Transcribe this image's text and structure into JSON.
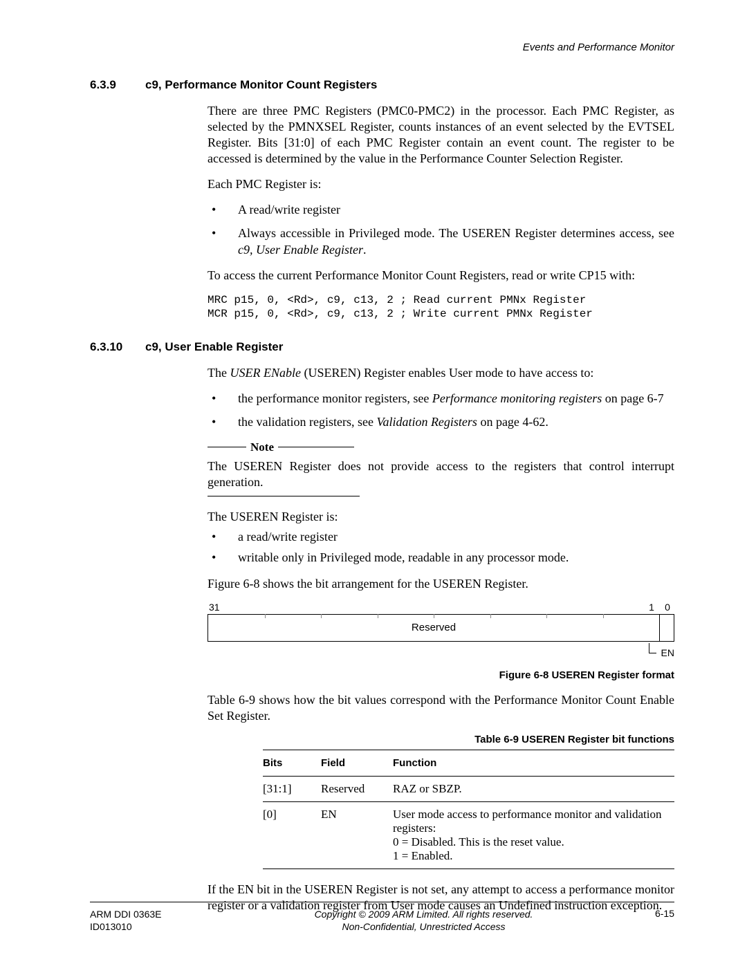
{
  "running_head": "Events and Performance Monitor",
  "sec639": {
    "num": "6.3.9",
    "title": "c9, Performance Monitor Count Registers",
    "p1": "There are three PMC Registers (PMC0-PMC2) in the processor. Each PMC Register, as selected by the PMNXSEL Register, counts instances of an event selected by the EVTSEL Register. Bits [31:0] of each PMC Register contain an event count. The register to be accessed is determined by the value in the Performance Counter Selection Register.",
    "p2": "Each PMC Register is:",
    "b1": "A read/write register",
    "b2a": "Always accessible in Privileged mode. The USEREN Register determines access, see ",
    "b2b": "c9, User Enable Register",
    "b2c": ".",
    "p3": "To access the current Performance Monitor Count Registers, read or write CP15 with:",
    "code": "MRC p15, 0, <Rd>, c9, c13, 2 ; Read current PMNx Register\nMCR p15, 0, <Rd>, c9, c13, 2 ; Write current PMNx Register"
  },
  "sec6310": {
    "num": "6.3.10",
    "title": "c9, User Enable Register",
    "p1a": "The ",
    "p1b": "USER ENable",
    "p1c": " (USEREN) Register enables User mode to have access to:",
    "b1a": "the performance monitor registers, see ",
    "b1b": "Performance monitoring registers",
    "b1c": " on page 6-7",
    "b2a": "the validation registers, see ",
    "b2b": "Validation Registers",
    "b2c": " on page 4-62.",
    "note_word": "Note",
    "note_body": "The USEREN Register does not provide access to the registers that control interrupt generation.",
    "p2": "The USEREN Register is:",
    "b3": "a read/write register",
    "b4": "writable only in Privileged mode, readable in any processor mode.",
    "p3": "Figure 6-8 shows the bit arrangement for the USEREN Register."
  },
  "register": {
    "bit31": "31",
    "bit1": "1",
    "bit0": "0",
    "reserved": "Reserved",
    "en": "EN"
  },
  "fig_caption": "Figure 6-8 USEREN Register format",
  "p_after_fig": "Table 6-9 shows how the bit values correspond with the Performance Monitor Count Enable Set Register.",
  "table_caption": "Table 6-9 USEREN Register bit functions",
  "table": {
    "h_bits": "Bits",
    "h_field": "Field",
    "h_function": "Function",
    "r1_bits": "[31:1]",
    "r1_field": "Reserved",
    "r1_fn": "RAZ or SBZP.",
    "r2_bits": "[0]",
    "r2_field": "EN",
    "r2_fn1": "User mode access to performance monitor and validation registers:",
    "r2_fn2": "0 = Disabled. This is the reset value.",
    "r2_fn3": "1 = Enabled."
  },
  "p_after_table": "If the EN bit in the USEREN Register is not set, any attempt to access a performance monitor register or a validation register from User mode causes an Undefined instruction exception.",
  "footer": {
    "left1": "ARM DDI 0363E",
    "left2": "ID013010",
    "center1": "Copyright © 2009 ARM Limited. All rights reserved.",
    "center2": "Non-Confidential, Unrestricted Access",
    "right": "6-15"
  }
}
